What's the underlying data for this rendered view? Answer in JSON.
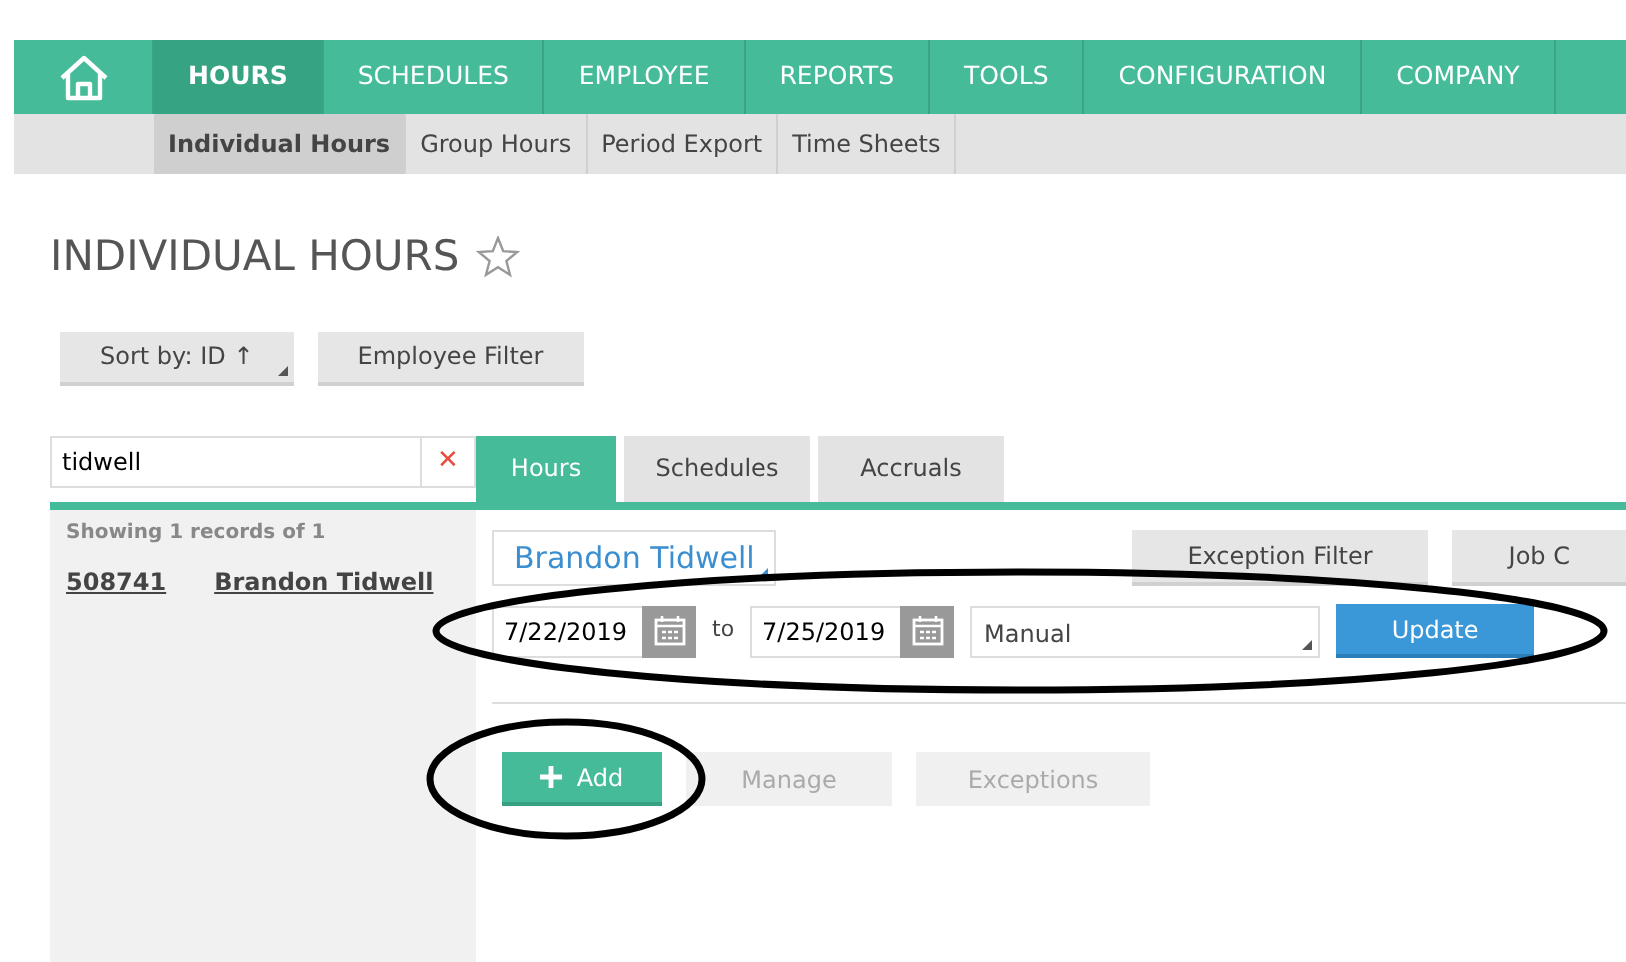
{
  "nav": {
    "items": [
      {
        "label": "HOURS",
        "selected": true
      },
      {
        "label": "SCHEDULES",
        "selected": false
      },
      {
        "label": "EMPLOYEE",
        "selected": false
      },
      {
        "label": "REPORTS",
        "selected": false
      },
      {
        "label": "TOOLS",
        "selected": false
      },
      {
        "label": "CONFIGURATION",
        "selected": false
      },
      {
        "label": "COMPANY",
        "selected": false
      }
    ]
  },
  "subnav": {
    "items": [
      {
        "label": "Individual Hours",
        "selected": true
      },
      {
        "label": "Group Hours",
        "selected": false
      },
      {
        "label": "Period Export",
        "selected": false
      },
      {
        "label": "Time Sheets",
        "selected": false
      }
    ]
  },
  "page_title": "INDIVIDUAL HOURS",
  "toolbar": [
    {
      "label": "Sort by: ID ↑",
      "dropdown": true
    },
    {
      "label": "Employee Filter",
      "dropdown": false
    }
  ],
  "search": {
    "value": "tidwell",
    "clear": "✕"
  },
  "records": {
    "summary": "Showing 1 records of 1",
    "rows": [
      {
        "id": "508741",
        "name": "Brandon Tidwell"
      }
    ]
  },
  "tabs": [
    {
      "label": "Hours",
      "selected": true
    },
    {
      "label": "Schedules",
      "selected": false
    },
    {
      "label": "Accruals",
      "selected": false
    }
  ],
  "employee": "Brandon Tidwell",
  "filters": [
    "Exception Filter",
    "Job C"
  ],
  "range": {
    "from": "7/22/2019",
    "to_label": "to",
    "to": "7/25/2019",
    "mode": "Manual",
    "button": "Update"
  },
  "actions": [
    {
      "label": "Add",
      "kind": "primary",
      "disabled": false
    },
    {
      "label": "Manage",
      "kind": "plain",
      "disabled": true
    },
    {
      "label": "Exceptions",
      "kind": "plain",
      "disabled": true
    }
  ]
}
